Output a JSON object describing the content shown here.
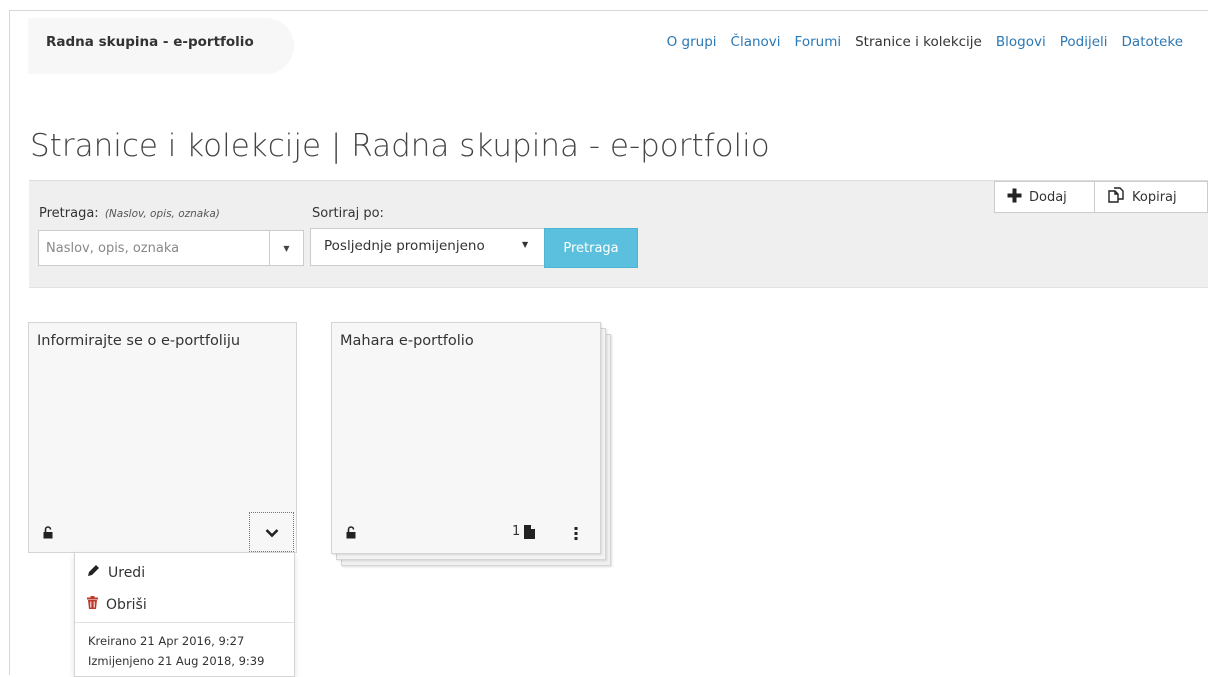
{
  "group": {
    "name": "Radna skupina - e-portfolio",
    "nav": [
      "O grupi",
      "Članovi",
      "Forumi",
      "Stranice i kolekcije",
      "Blogovi",
      "Podijeli",
      "Datoteke"
    ],
    "active_nav": "Stranice i kolekcije"
  },
  "page_title": "Stranice i kolekcije | Radna skupina - e-portfolio",
  "toolbar": {
    "search_label": "Pretraga:",
    "search_hint": "(Naslov, opis, oznaka)",
    "search_placeholder": "Naslov, opis, oznaka",
    "sort_label": "Sortiraj po:",
    "sort_value": "Posljednje promijenjeno",
    "search_button": "Pretraga",
    "add_button": "Dodaj",
    "copy_button": "Kopiraj"
  },
  "cards": [
    {
      "title": "Informirajte se o e-portfoliju",
      "menu": {
        "edit_label": "Uredi",
        "delete_label": "Obriši",
        "created": "Kreirano 21 Apr 2016, 9:27",
        "modified": "Izmijenjeno 21 Aug 2018, 9:39"
      }
    },
    {
      "title": "Mahara e-portfolio",
      "page_count": "1"
    }
  ],
  "colors": {
    "link": "#2a78b5",
    "primary_button": "#5bc0de",
    "delete_icon": "#c0392b"
  }
}
